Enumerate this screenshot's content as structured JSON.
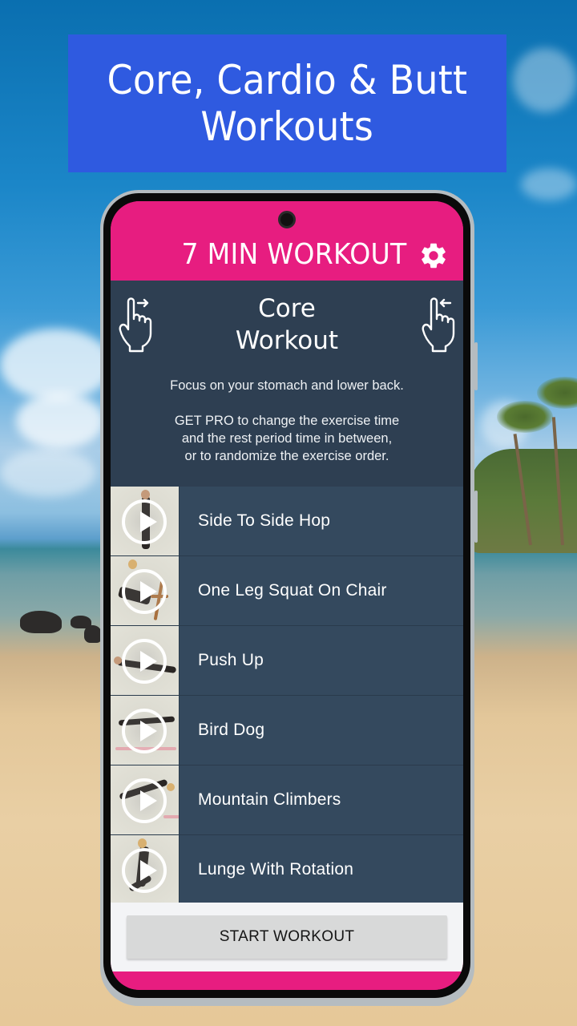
{
  "banner": {
    "line1": "Core, Cardio & Butt",
    "line2": "Workouts",
    "background_color": "#2f5ae0"
  },
  "app": {
    "title": "7 MIN WORKOUT",
    "accent_color": "#e71d80",
    "settings_icon": "gear-icon"
  },
  "workout": {
    "title_line1": "Core",
    "title_line2": "Workout",
    "swipe_left_icon": "swipe-right-hand-icon",
    "swipe_right_icon": "swipe-left-hand-icon",
    "description": "Focus on your stomach and lower back.",
    "pro_line1": "GET PRO to change the exercise time",
    "pro_line2": "and the rest period time in between,",
    "pro_line3": "or to randomize the exercise order.",
    "panel_color": "#2e3f52"
  },
  "exercises": [
    {
      "name": "Side To Side Hop",
      "icon": "play-icon"
    },
    {
      "name": "One Leg Squat On Chair",
      "icon": "play-icon"
    },
    {
      "name": "Push Up",
      "icon": "play-icon"
    },
    {
      "name": "Bird Dog",
      "icon": "play-icon"
    },
    {
      "name": "Mountain Climbers",
      "icon": "play-icon"
    },
    {
      "name": "Lunge With Rotation",
      "icon": "play-icon"
    }
  ],
  "actions": {
    "start_label": "START WORKOUT"
  }
}
